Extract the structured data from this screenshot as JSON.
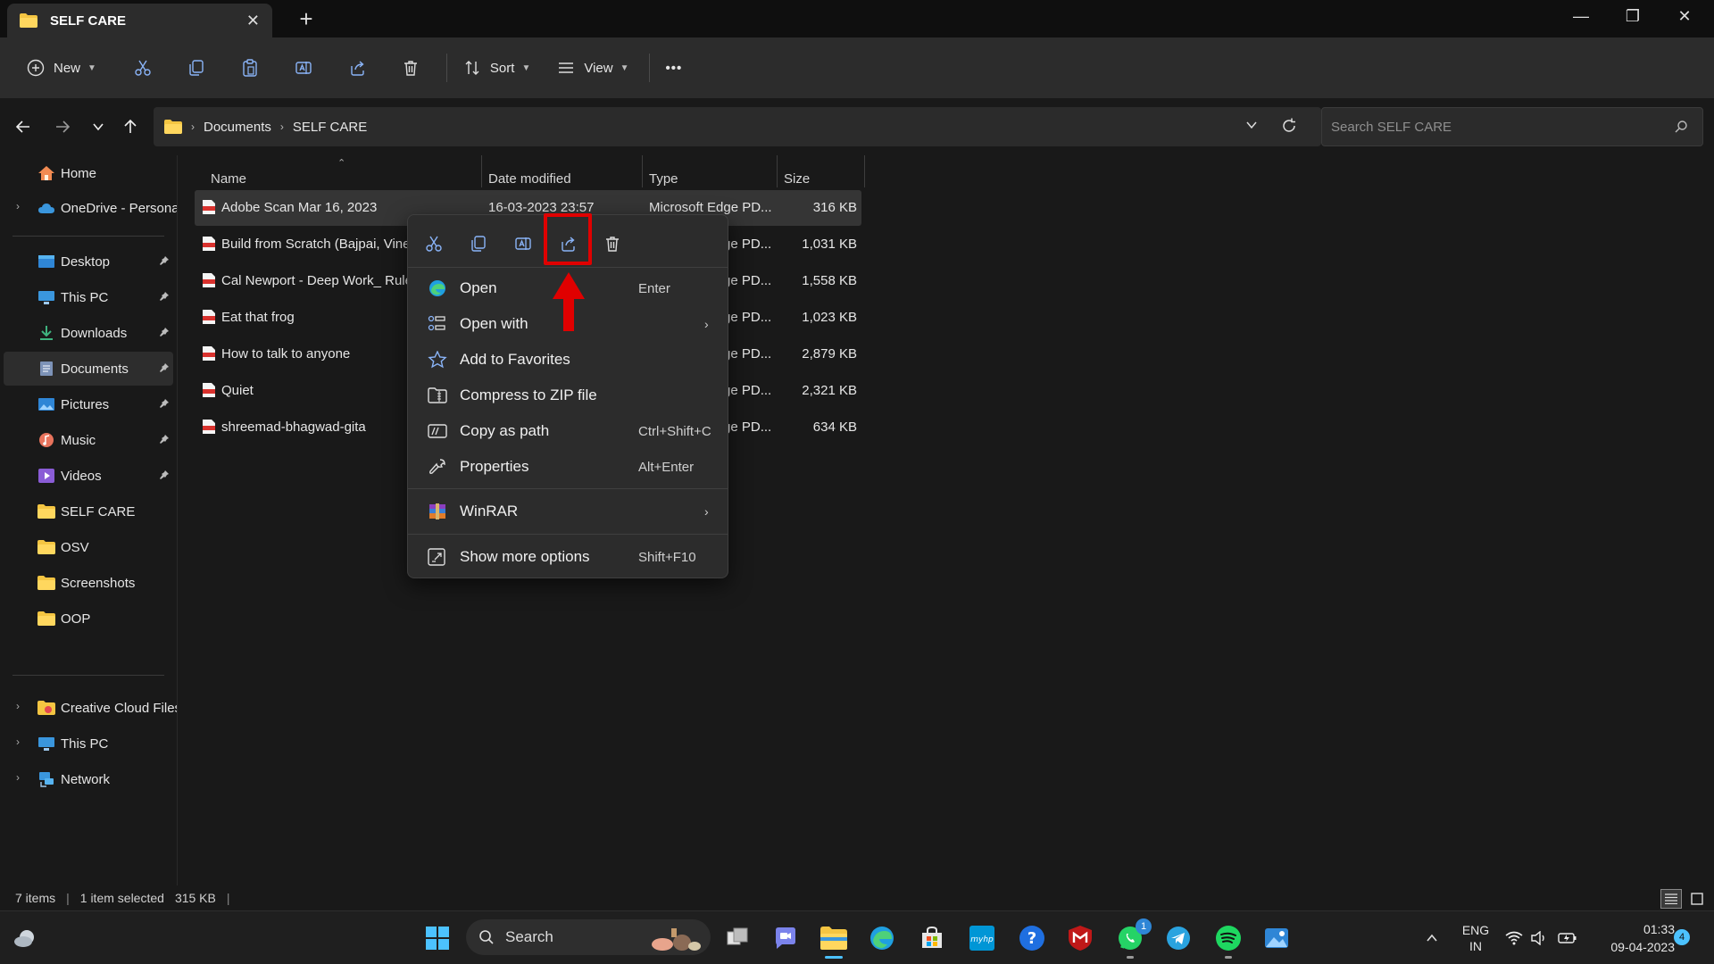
{
  "window": {
    "tab_title": "SELF CARE",
    "new_tab": "+",
    "tab_close": "✕",
    "minimize": "—",
    "maximize": "❐",
    "close": "✕"
  },
  "toolbar": {
    "new_label": "New",
    "sort_label": "Sort",
    "view_label": "View",
    "more_label": "•••"
  },
  "address": {
    "crumbs": [
      "Documents",
      "SELF CARE"
    ],
    "search_placeholder": "Search SELF CARE"
  },
  "sidebar": {
    "items": [
      {
        "label": "Home"
      },
      {
        "label": "OneDrive - Persona"
      },
      {
        "label": "Desktop"
      },
      {
        "label": "This PC"
      },
      {
        "label": "Downloads"
      },
      {
        "label": "Documents"
      },
      {
        "label": "Pictures"
      },
      {
        "label": "Music"
      },
      {
        "label": "Videos"
      },
      {
        "label": "SELF CARE"
      },
      {
        "label": "OSV"
      },
      {
        "label": "Screenshots"
      },
      {
        "label": "OOP"
      },
      {
        "label": "Creative Cloud Files"
      },
      {
        "label": "This PC"
      },
      {
        "label": "Network"
      }
    ]
  },
  "columns": {
    "name": "Name",
    "date": "Date modified",
    "type": "Type",
    "size": "Size"
  },
  "files": [
    {
      "name": "Adobe Scan Mar 16, 2023",
      "date": "16-03-2023 23:57",
      "type": "Microsoft Edge PD...",
      "size": "316 KB"
    },
    {
      "name": "Build from Scratch (Bajpai, Vine",
      "type": "ge PD...",
      "size": "1,031 KB"
    },
    {
      "name": "Cal Newport - Deep Work_ Rule",
      "type": "ge PD...",
      "size": "1,558 KB"
    },
    {
      "name": "Eat that frog",
      "type": "ge PD...",
      "size": "1,023 KB"
    },
    {
      "name": "How to talk to anyone",
      "type": "ge PD...",
      "size": "2,879 KB"
    },
    {
      "name": "Quiet",
      "type": "ge PD...",
      "size": "2,321 KB"
    },
    {
      "name": "shreemad-bhagwad-gita",
      "type": "ge PD...",
      "size": "634 KB"
    }
  ],
  "context_menu": {
    "items": [
      {
        "label": "Open",
        "shortcut": "Enter"
      },
      {
        "label": "Open with",
        "arrow": "›"
      },
      {
        "label": "Add to Favorites"
      },
      {
        "label": "Compress to ZIP file"
      },
      {
        "label": "Copy as path",
        "shortcut": "Ctrl+Shift+C"
      },
      {
        "label": "Properties",
        "shortcut": "Alt+Enter"
      },
      {
        "label": "WinRAR",
        "arrow": "›"
      },
      {
        "label": "Show more options",
        "shortcut": "Shift+F10"
      }
    ],
    "highlight_color": "#e00000"
  },
  "status": {
    "items_count": "7 items",
    "selection": "1 item selected",
    "selection_size": "315 KB"
  },
  "taskbar": {
    "search_label": "Search",
    "whatsapp_badge": "1",
    "lang_line1": "ENG",
    "lang_line2": "IN",
    "time": "01:33",
    "date": "09-04-2023",
    "notification_count": "4"
  }
}
